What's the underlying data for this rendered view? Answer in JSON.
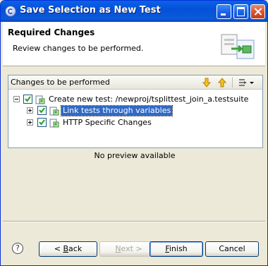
{
  "window": {
    "title": "Save Selection as New Test"
  },
  "header": {
    "title": "Required Changes",
    "description": "Review changes to be performed."
  },
  "changes_panel": {
    "label": "Changes to be performed",
    "tree": [
      {
        "label": "Create new test: /newproj/tsplittest_join_a.testsuite",
        "checked": true,
        "expanded": true,
        "children": [
          {
            "label": "Link tests through variables",
            "checked": true,
            "expanded": false,
            "selected": true
          },
          {
            "label": "HTTP Specific Changes",
            "checked": true,
            "expanded": false,
            "selected": false
          }
        ]
      }
    ]
  },
  "preview": {
    "text": "No preview available"
  },
  "buttons": {
    "back": {
      "mnemonic": "B",
      "rest": "ack",
      "prefix": "< "
    },
    "next": {
      "mnemonic": "N",
      "rest": "ext >",
      "enabled": false
    },
    "finish": {
      "mnemonic": "F",
      "rest": "inish"
    },
    "cancel": {
      "label": "Cancel"
    }
  },
  "icons": {
    "app": "eclipse-icon",
    "help": "help-icon",
    "down": "arrow-down-icon",
    "up": "arrow-up-icon",
    "view_menu": "view-menu-icon"
  },
  "colors": {
    "titlebar": "#0a5ad9",
    "selection": "#316ac5"
  }
}
